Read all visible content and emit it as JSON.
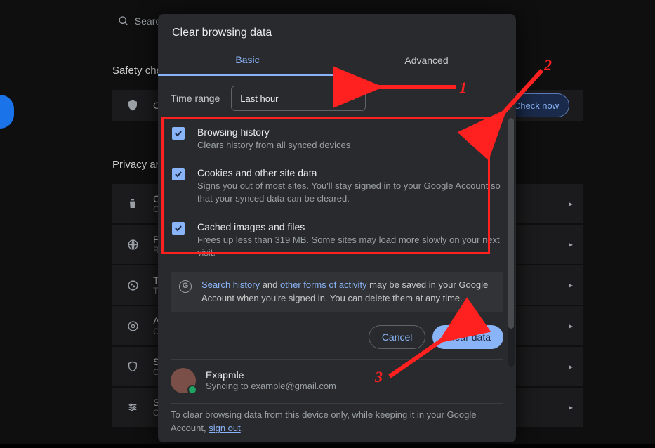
{
  "bg": {
    "search_placeholder": "Search",
    "safety_heading": "Safety check",
    "check_now": "Check now",
    "privacy_heading": "Privacy and security",
    "row_c": "C",
    "row_p": "P",
    "row_r": "R",
    "row_t": "T",
    "row_a": "A",
    "row_s": "S"
  },
  "modal": {
    "title": "Clear browsing data",
    "tabs": {
      "basic": "Basic",
      "advanced": "Advanced"
    },
    "time_range_label": "Time range",
    "time_range_value": "Last hour",
    "options": [
      {
        "title": "Browsing history",
        "desc": "Clears history from all synced devices"
      },
      {
        "title": "Cookies and other site data",
        "desc": "Signs you out of most sites. You'll stay signed in to your Google Account so that your synced data can be cleared."
      },
      {
        "title": "Cached images and files",
        "desc": "Frees up less than 319 MB. Some sites may load more slowly on your next visit."
      }
    ],
    "info": {
      "link1": "Search history",
      "mid1": " and ",
      "link2": "other forms of activity",
      "rest": " may be saved in your Google Account when you're signed in. You can delete them at any time."
    },
    "buttons": {
      "cancel": "Cancel",
      "clear": "Clear data"
    },
    "account": {
      "name": "Exapmle",
      "sub": "Syncing to example@gmail.com"
    },
    "footer": {
      "pre": "To clear browsing data from this device only, while keeping it in your Google Account, ",
      "link": "sign out",
      "post": "."
    }
  },
  "annotations": {
    "n1": "1",
    "n2": "2",
    "n3": "3"
  }
}
